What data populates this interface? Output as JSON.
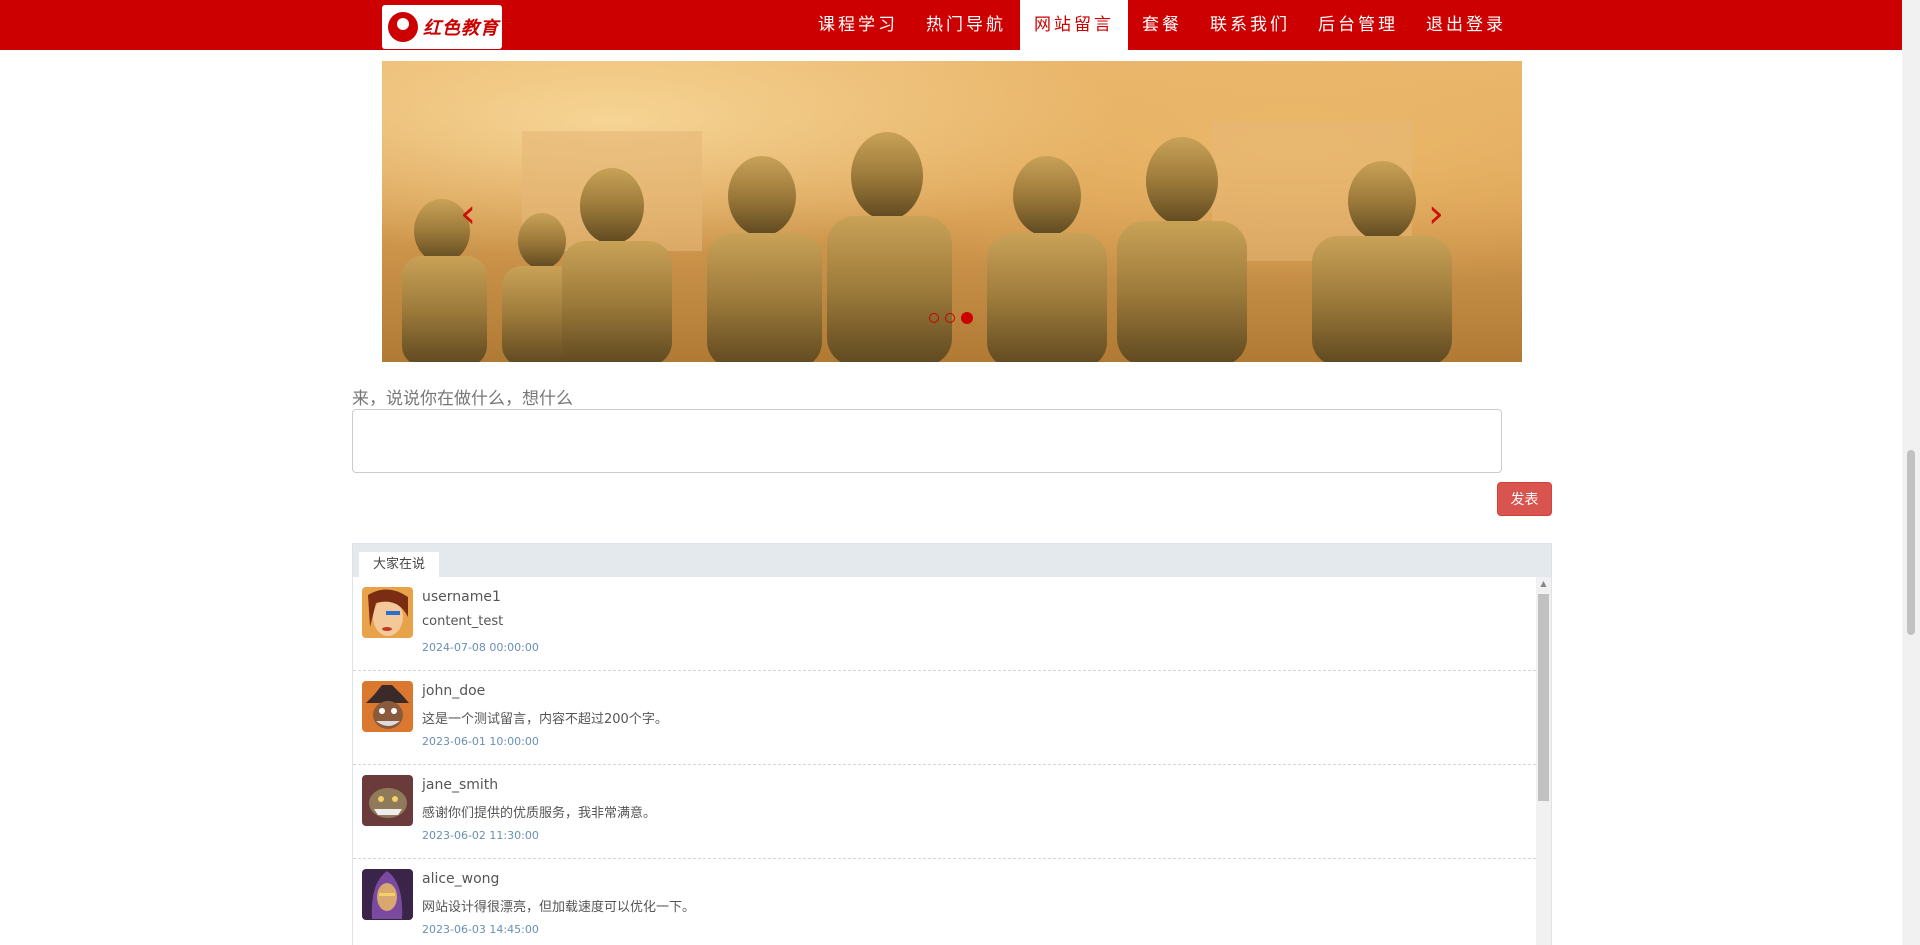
{
  "brand": {
    "logo_text": "红色教育"
  },
  "nav": {
    "items": [
      {
        "label": "课程学习"
      },
      {
        "label": "热门导航"
      },
      {
        "label": "网站留言",
        "active": true
      },
      {
        "label": "套餐"
      },
      {
        "label": "联系我们"
      },
      {
        "label": "后台管理"
      },
      {
        "label": "退出登录"
      }
    ]
  },
  "carousel": {
    "slide_count": 3,
    "active_slide": 3,
    "prev_icon": "chevron-left-icon",
    "next_icon": "chevron-right-icon"
  },
  "compose": {
    "prompt": "来，说说你在做什么，想什么",
    "input_value": "",
    "submit_label": "发表"
  },
  "comments": {
    "tab_label": "大家在说",
    "items": [
      {
        "username": "username1",
        "content": "content_test",
        "time": "2024-07-08 00:00:00"
      },
      {
        "username": "john_doe",
        "content": "这是一个测试留言，内容不超过200个字。",
        "time": "2023-06-01 10:00:00"
      },
      {
        "username": "jane_smith",
        "content": "感谢你们提供的优质服务，我非常满意。",
        "time": "2023-06-02 11:30:00"
      },
      {
        "username": "alice_wong",
        "content": "网站设计得很漂亮，但加载速度可以优化一下。",
        "time": "2023-06-03 14:45:00"
      }
    ]
  },
  "colors": {
    "brand_red": "#cc0000",
    "button_red": "#d9534f",
    "timestamp_blue": "#6a8fb5"
  }
}
